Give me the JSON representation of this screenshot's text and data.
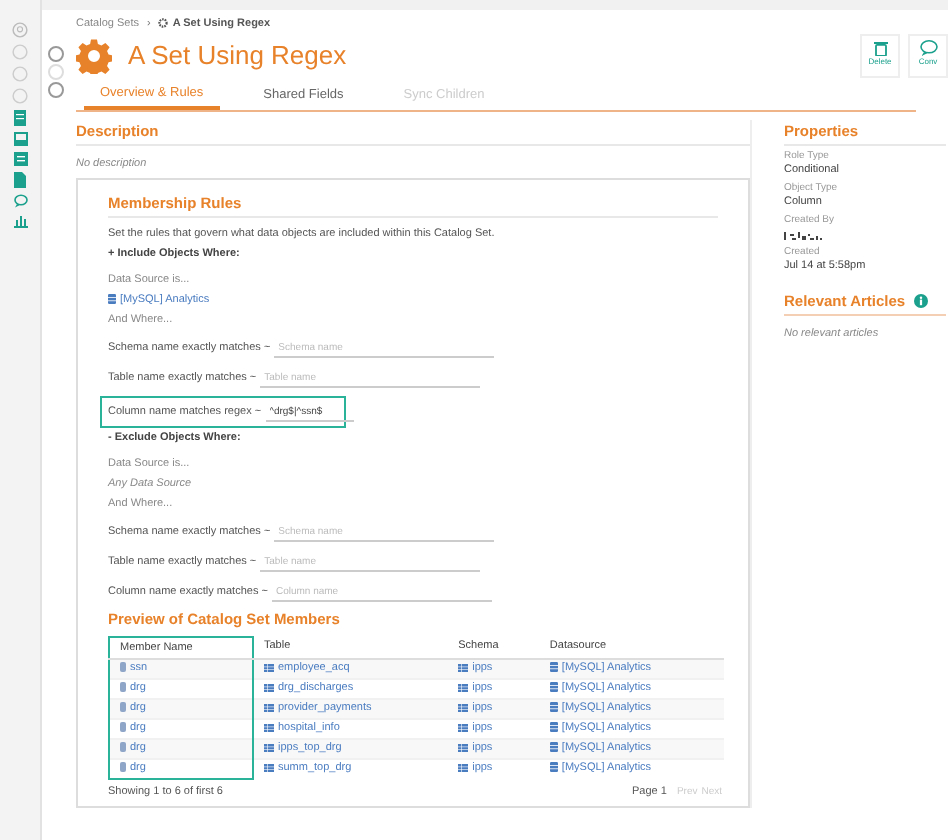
{
  "breadcrumb": {
    "items": [
      "Catalog Sets",
      "A Set Using Regex"
    ],
    "separator": "›"
  },
  "title": "A Set Using Regex",
  "toolbar": [
    {
      "label": "Delete",
      "kind": "delete"
    },
    {
      "label": "Conv",
      "kind": "comment"
    }
  ],
  "tabs": [
    {
      "label": "Overview & Rules",
      "selected": true,
      "disabled": false
    },
    {
      "label": "Shared Fields",
      "selected": false,
      "disabled": false
    },
    {
      "label": "Sync Children",
      "selected": false,
      "disabled": true
    }
  ],
  "description": {
    "heading": "Description",
    "text": "No description"
  },
  "membership": {
    "heading": "Membership Rules",
    "intro": "Set the rules that govern what data objects are included within this Catalog Set.",
    "sections": [
      {
        "heading": "+ Include Objects Where:",
        "data_source_label": "Data Source is...",
        "data_source": "[MySQL] Analytics",
        "data_source_set": true,
        "and_where": "And Where...",
        "rules": [
          {
            "label": "Schema name exactly matches ~",
            "placeholder": "Schema name",
            "highlighted": false
          },
          {
            "label": "Table name exactly matches ~",
            "placeholder": "Table name",
            "highlighted": false
          },
          {
            "label": "Column name matches regex ~",
            "value": "^drg$|^ssn$",
            "highlighted": true
          }
        ]
      },
      {
        "heading": "- Exclude Objects Where:",
        "data_source_label": "Data Source is...",
        "data_source": "Any Data Source",
        "data_source_set": false,
        "and_where": "And Where...",
        "rules": [
          {
            "label": "Schema name exactly matches ~",
            "placeholder": "Schema name",
            "highlighted": false
          },
          {
            "label": "Table name exactly matches ~",
            "placeholder": "Table name",
            "highlighted": false
          },
          {
            "label": "Column name exactly matches ~",
            "placeholder": "Column name",
            "highlighted": false
          }
        ]
      }
    ]
  },
  "preview": {
    "heading": "Preview of Catalog Set Members",
    "columns": [
      "Member Name",
      "Table",
      "Schema",
      "Datasource"
    ],
    "rows": [
      [
        "ssn",
        "employee_acq",
        "ipps",
        "[MySQL] Analytics"
      ],
      [
        "drg",
        "drg_discharges",
        "ipps",
        "[MySQL] Analytics"
      ],
      [
        "drg",
        "provider_payments",
        "ipps",
        "[MySQL] Analytics"
      ],
      [
        "drg",
        "hospital_info",
        "ipps",
        "[MySQL] Analytics"
      ],
      [
        "drg",
        "ipps_top_drg",
        "ipps",
        "[MySQL] Analytics"
      ],
      [
        "drg",
        "summ_top_drg",
        "ipps",
        "[MySQL] Analytics"
      ]
    ],
    "footer": "Showing 1 to 6 of first 6",
    "page": "Page 1",
    "prev": {
      "label": "Prev",
      "disabled": true
    },
    "next": {
      "label": "Next",
      "disabled": true
    }
  },
  "properties": {
    "heading": "Properties",
    "items": [
      {
        "label": "Role Type",
        "value": "Conditional",
        "redacted": false
      },
      {
        "label": "Object Type",
        "value": "Column",
        "redacted": false
      },
      {
        "label": "Created By",
        "redacted": true
      },
      {
        "label": "Created",
        "value": "Jul 14 at 5:58pm",
        "redacted": false
      }
    ]
  },
  "relevant_articles": {
    "heading": "Relevant Articles",
    "text": "No relevant articles"
  }
}
